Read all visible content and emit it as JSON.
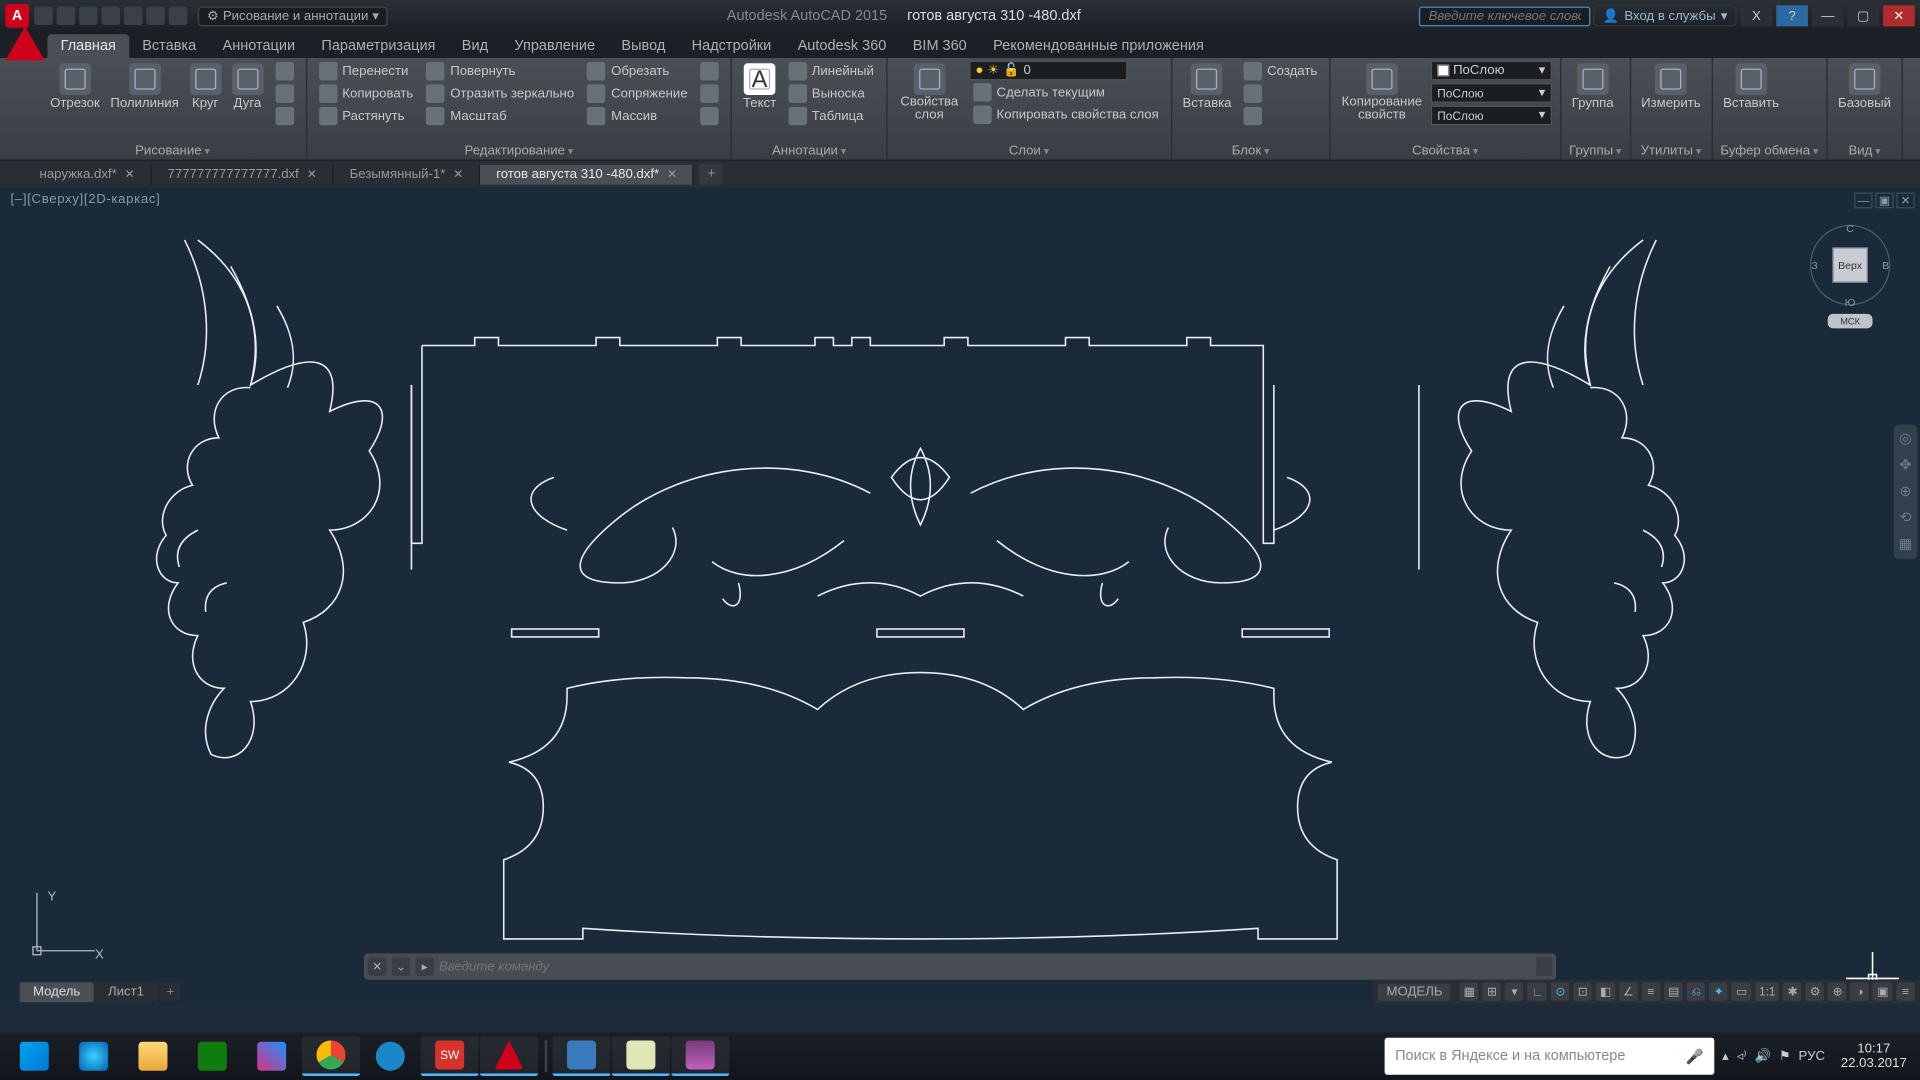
{
  "titlebar": {
    "workspace": "Рисование и аннотации",
    "app_name": "Autodesk AutoCAD 2015",
    "doc_name": "готов августа 310 -480.dxf",
    "search_placeholder": "Введите ключевое слово/фразу",
    "signin": "Вход в службы"
  },
  "menubar": {
    "tabs": [
      "Главная",
      "Вставка",
      "Аннотации",
      "Параметризация",
      "Вид",
      "Управление",
      "Вывод",
      "Надстройки",
      "Autodesk 360",
      "BIM 360",
      "Рекомендованные приложения"
    ]
  },
  "ribbon": {
    "draw": {
      "title": "Рисование",
      "line": "Отрезок",
      "polyline": "Полилиния",
      "circle": "Круг",
      "arc": "Дуга"
    },
    "modify": {
      "title": "Редактирование",
      "move": "Перенести",
      "rotate": "Повернуть",
      "trim": "Обрезать",
      "copy": "Копировать",
      "mirror": "Отразить зеркально",
      "fillet": "Сопряжение",
      "stretch": "Растянуть",
      "scale": "Масштаб",
      "array": "Массив"
    },
    "annot": {
      "title": "Аннотации",
      "text": "Текст",
      "linear": "Линейный",
      "leader": "Выноска",
      "table": "Таблица"
    },
    "layers": {
      "title": "Слои",
      "props": "Свойства слоя",
      "current_layer": "0",
      "make_current": "Сделать текущим",
      "match": "Копировать свойства слоя"
    },
    "block": {
      "title": "Блок",
      "insert": "Вставка",
      "create": "Создать"
    },
    "props": {
      "title": "Свойства",
      "match": "Копирование свойств",
      "bylayer_color": "ПоСлою",
      "bylayer_lw": "ПоСлою",
      "bylayer_lt": "ПоСлою"
    },
    "groups": {
      "title": "Группы",
      "group": "Группа"
    },
    "utils": {
      "title": "Утилиты",
      "measure": "Измерить"
    },
    "clipboard": {
      "title": "Буфер обмена",
      "paste": "Вставить"
    },
    "view": {
      "title": "Вид",
      "base": "Базовый"
    }
  },
  "doctabs": {
    "tabs": [
      {
        "label": "наружка.dxf*"
      },
      {
        "label": "777777777777777.dxf"
      },
      {
        "label": "Безымянный-1*"
      },
      {
        "label": "готов августа 310 -480.dxf*"
      }
    ],
    "active_index": 3
  },
  "viewport_label": "[–][Сверху][2D-каркас]",
  "viewcube": {
    "top": "С",
    "left": "З",
    "right": "В",
    "bottom": "Ю",
    "face": "Верх",
    "wcs": "МСК"
  },
  "ucs": {
    "x": "X",
    "y": "Y"
  },
  "cmdline": {
    "placeholder": "Введите команду"
  },
  "layouttabs": {
    "model": "Модель",
    "sheet": "Лист1"
  },
  "statusbar": {
    "model": "МОДЕЛЬ",
    "scale": "1:1"
  },
  "wintask": {
    "search_placeholder": "Поиск в Яндексе и на компьютере",
    "lang": "РУС",
    "time": "10:17",
    "date": "22.03.2017"
  }
}
